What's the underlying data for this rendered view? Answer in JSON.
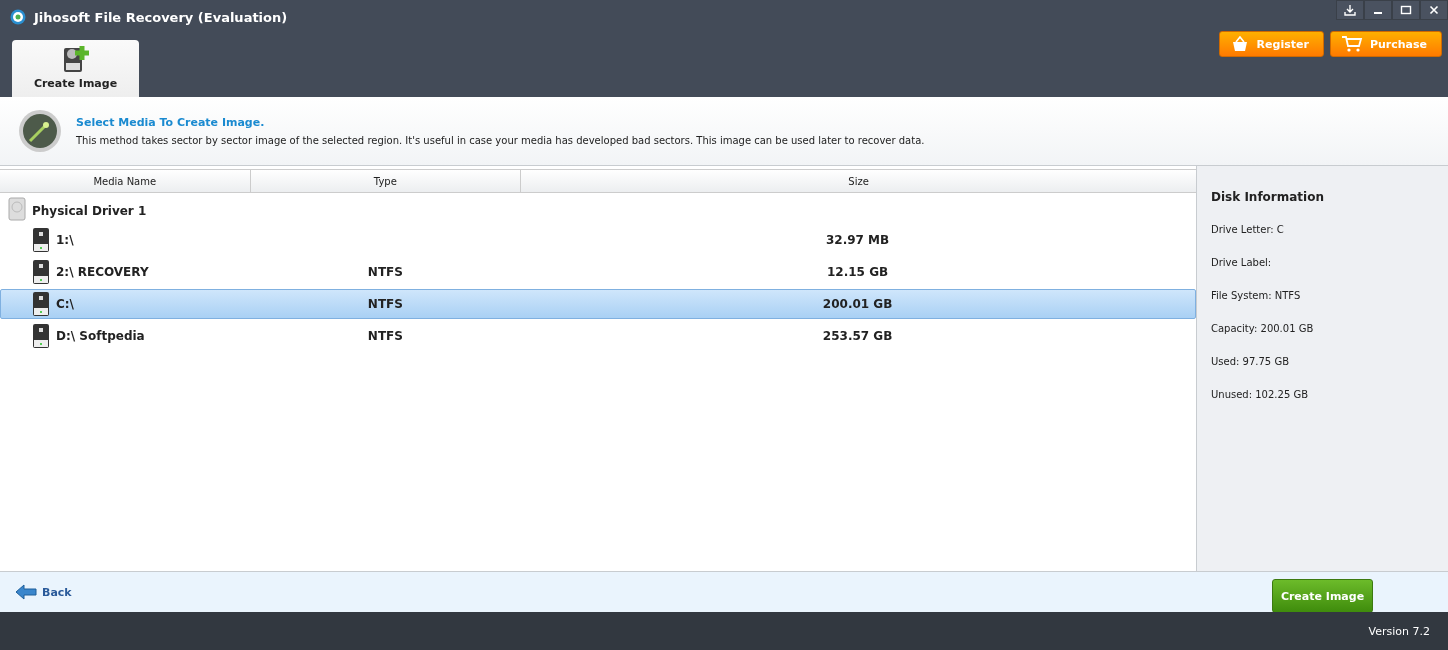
{
  "window": {
    "title": "Jihosoft File Recovery (Evaluation)"
  },
  "tabs": [
    {
      "label": "Create Image",
      "selected": true
    }
  ],
  "top_buttons": [
    {
      "label": "Register",
      "kind": "basket"
    },
    {
      "label": "Purchase",
      "kind": "cart"
    }
  ],
  "intro": {
    "title": "Select Media To Create Image.",
    "description": "This method takes sector by sector image of the selected region. It's useful in case your media has developed bad sectors. This image can be used later to recover data."
  },
  "table": {
    "columns": [
      "Media Name",
      "Type",
      "Size"
    ],
    "rows": [
      {
        "name": "Physical Driver 1",
        "kind": "disk",
        "selected": false,
        "children": [
          {
            "name": "1:\\",
            "size": "32.97 MB",
            "kind": "volume",
            "selected": false
          },
          {
            "name": "2:\\ RECOVERY",
            "type": "NTFS",
            "size": "12.15 GB",
            "kind": "volume",
            "selected": false
          },
          {
            "name": "C:\\",
            "type": "NTFS",
            "size": "200.01 GB",
            "kind": "volume",
            "selected": true
          },
          {
            "name": "D:\\ Softpedia",
            "type": "NTFS",
            "size": "253.57 GB",
            "kind": "volume",
            "selected": false
          }
        ]
      }
    ]
  },
  "disk_information": {
    "title": "Disk Information",
    "lines": [
      "Drive Letter: C",
      "Drive Label:",
      "File System: NTFS",
      "Capacity: 200.01 GB",
      "Used: 97.75 GB",
      "Unused: 102.25 GB"
    ]
  },
  "footer": {
    "back": "Back",
    "create": "Create Image"
  },
  "status_bar": {
    "version": "Version 7.2"
  }
}
